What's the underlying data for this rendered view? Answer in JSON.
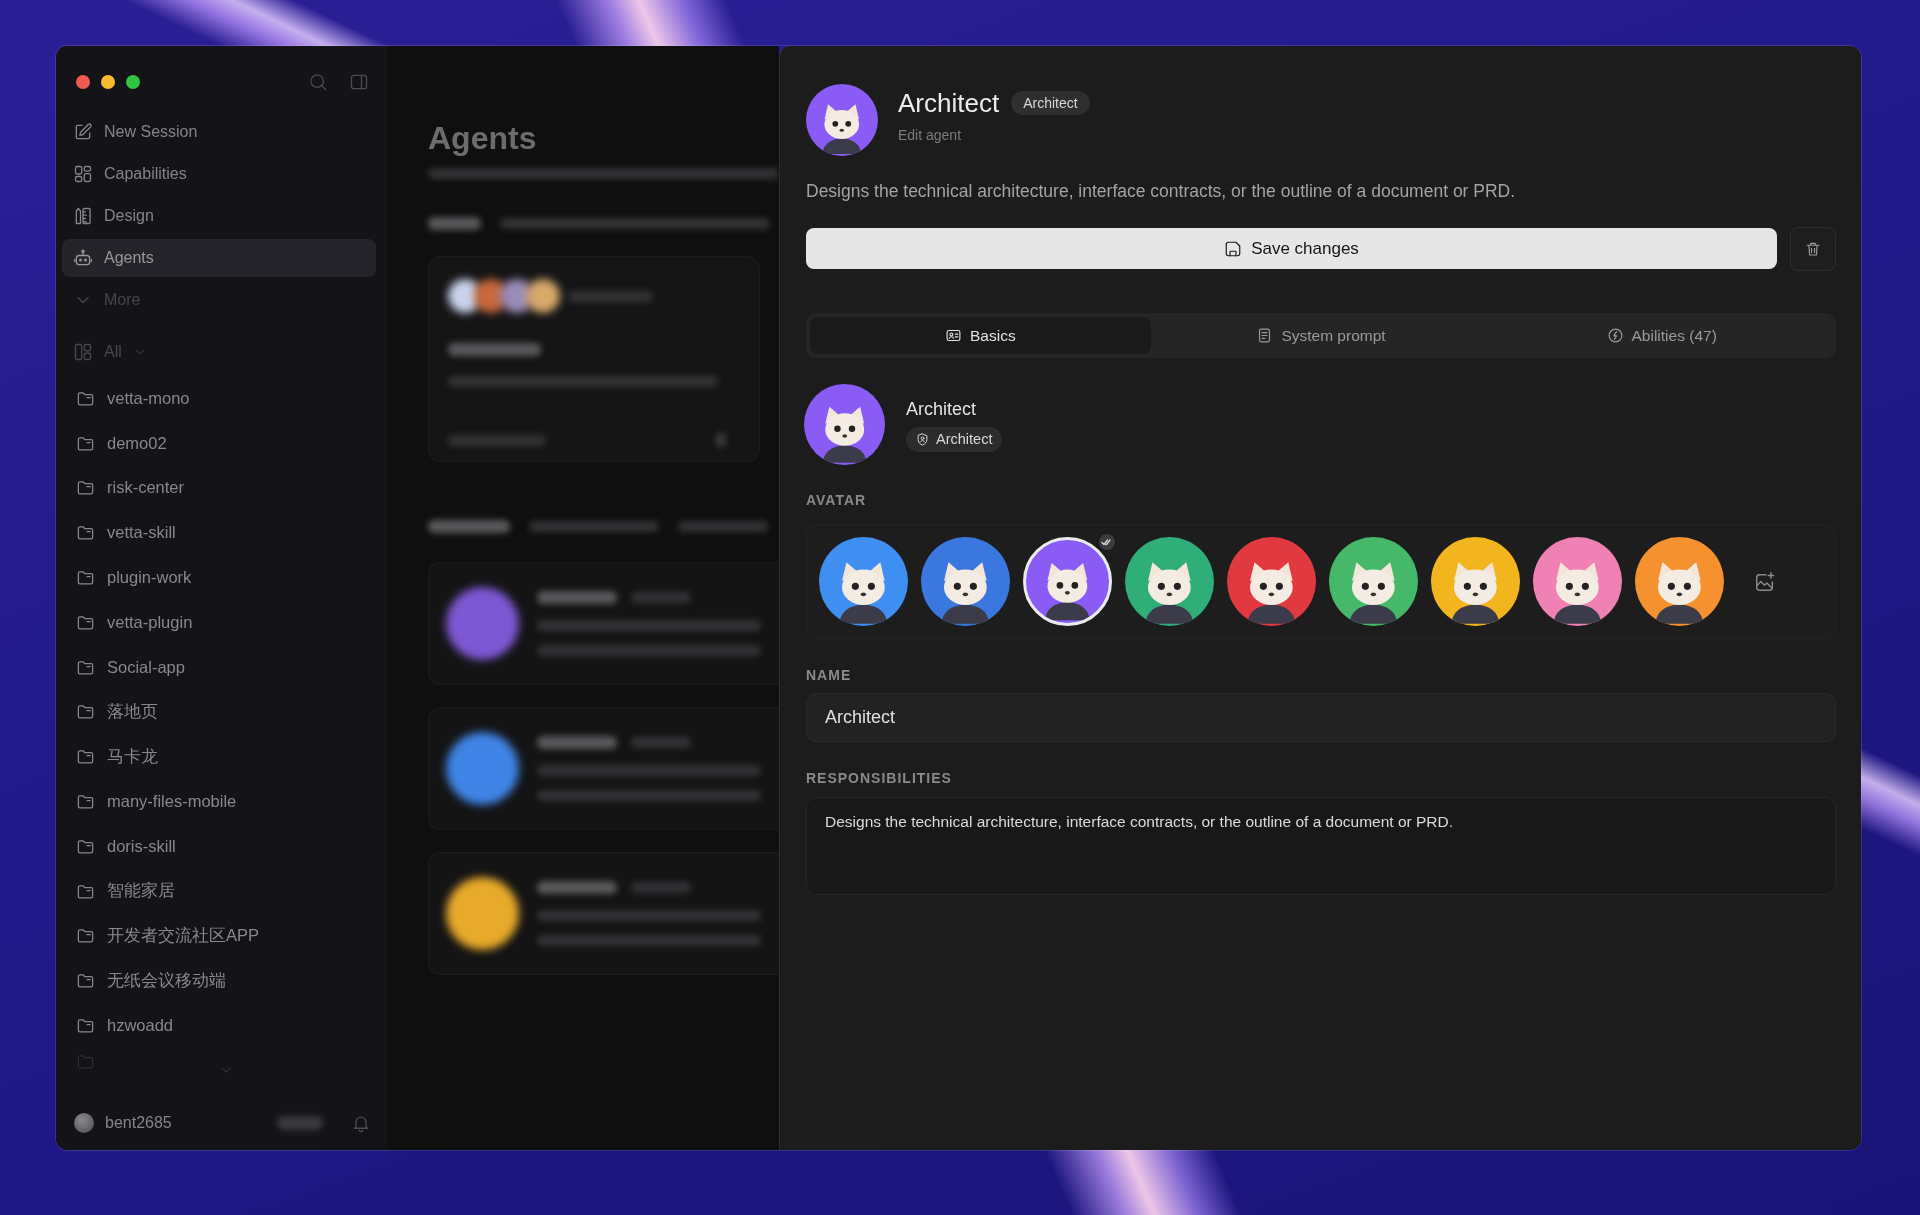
{
  "sidebar": {
    "nav": [
      {
        "label": "New Session",
        "selected": false
      },
      {
        "label": "Capabilities",
        "selected": false
      },
      {
        "label": "Design",
        "selected": false
      },
      {
        "label": "Agents",
        "selected": true
      }
    ],
    "more": {
      "label": "More"
    },
    "filter": {
      "label": "All"
    },
    "projects": [
      "vetta-mono",
      "demo02",
      "risk-center",
      "vetta-skill",
      "plugin-work",
      "vetta-plugin",
      "Social-app",
      "落地页",
      "马卡龙",
      "many-files-mobile",
      "doris-skill",
      "智能家居",
      "开发者交流社区APP",
      "无纸会议移动端",
      "hzwoadd"
    ],
    "user": {
      "name": "bent2685"
    }
  },
  "main": {
    "title": "Agents"
  },
  "panel": {
    "header": {
      "title": "Architect",
      "badge": "Architect",
      "subtitle": "Edit agent"
    },
    "description": "Designs the technical architecture, interface contracts, or the outline of a document or PRD.",
    "save_button": {
      "label": "Save changes"
    },
    "tabs": [
      {
        "label": "Basics",
        "selected": true
      },
      {
        "label": "System prompt",
        "selected": false
      },
      {
        "label": "Abilities (47)",
        "selected": false
      }
    ],
    "preview": {
      "name": "Architect",
      "role": "Architect"
    },
    "avatar": {
      "label": "AVATAR",
      "options": [
        {
          "color": "#3f8ef2",
          "selected": false
        },
        {
          "color": "#3a78e0",
          "selected": false
        },
        {
          "color": "#8a5cf5",
          "selected": true
        },
        {
          "color": "#2fae7a",
          "selected": false
        },
        {
          "color": "#e0393f",
          "selected": false
        },
        {
          "color": "#46b86a",
          "selected": false
        },
        {
          "color": "#f3b51e",
          "selected": false
        },
        {
          "color": "#f081b4",
          "selected": false
        },
        {
          "color": "#f5912f",
          "selected": false
        }
      ]
    },
    "name_field": {
      "label": "NAME",
      "value": "Architect"
    },
    "responsibilities_field": {
      "label": "RESPONSIBILITIES",
      "value": "Designs the technical architecture, interface contracts, or the outline of a document or PRD."
    }
  }
}
